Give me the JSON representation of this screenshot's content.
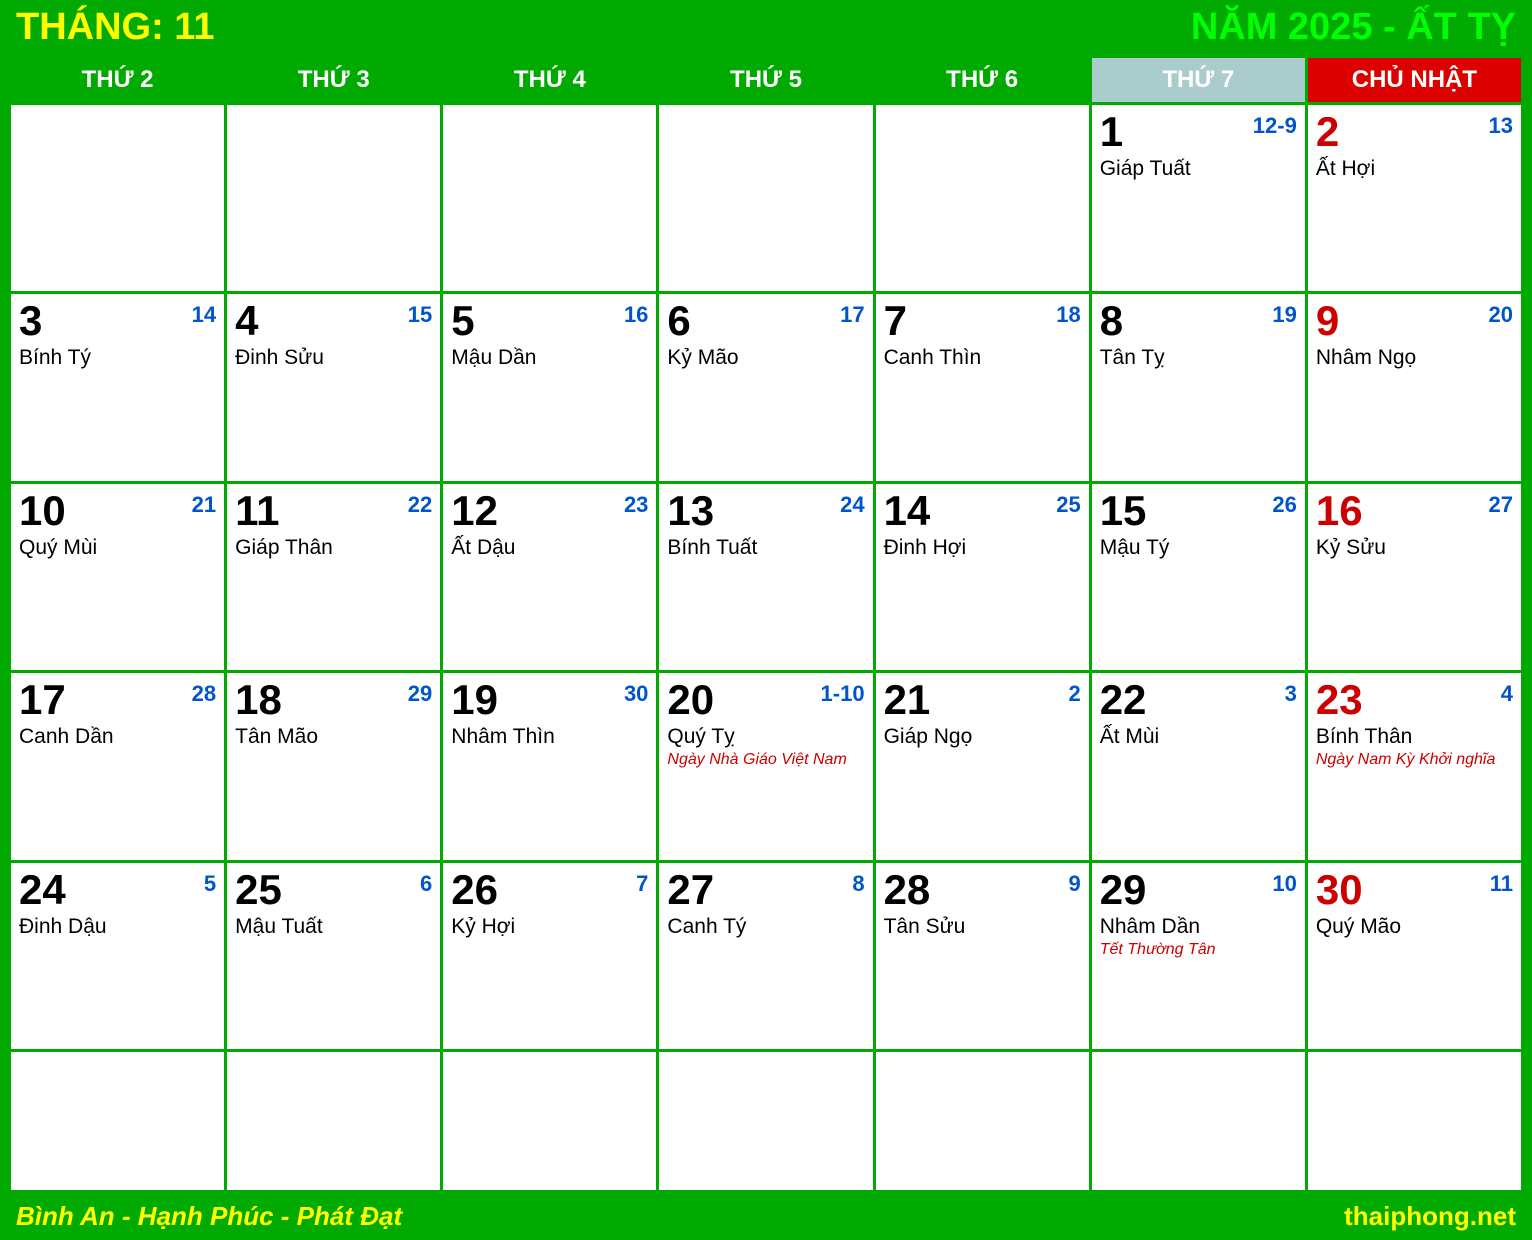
{
  "header": {
    "month_label": "THÁNG: 11",
    "year_label": "NĂM 2025 - ẤT TỴ"
  },
  "weekdays": [
    {
      "label": "THỨ 2",
      "type": "normal"
    },
    {
      "label": "THỨ 3",
      "type": "normal"
    },
    {
      "label": "THỨ 4",
      "type": "normal"
    },
    {
      "label": "THỨ 5",
      "type": "normal"
    },
    {
      "label": "THỨ 6",
      "type": "normal"
    },
    {
      "label": "THỨ 7",
      "type": "saturday"
    },
    {
      "label": "CHỦ NHẬT",
      "type": "sunday"
    }
  ],
  "rows": [
    [
      {
        "day": "",
        "lunar": "",
        "lunar_name": "",
        "event": "",
        "empty": true
      },
      {
        "day": "",
        "lunar": "",
        "lunar_name": "",
        "event": "",
        "empty": true
      },
      {
        "day": "",
        "lunar": "",
        "lunar_name": "",
        "event": "",
        "empty": true
      },
      {
        "day": "",
        "lunar": "",
        "lunar_name": "",
        "event": "",
        "empty": true
      },
      {
        "day": "",
        "lunar": "",
        "lunar_name": "",
        "event": "",
        "empty": true
      },
      {
        "day": "1",
        "lunar": "12-9",
        "lunar_name": "Giáp Tuất",
        "event": "",
        "empty": false,
        "is_sunday": false
      },
      {
        "day": "2",
        "lunar": "13",
        "lunar_name": "Ất Hợi",
        "event": "",
        "empty": false,
        "is_sunday": true
      }
    ],
    [
      {
        "day": "3",
        "lunar": "14",
        "lunar_name": "Bính Tý",
        "event": "",
        "empty": false,
        "is_sunday": false
      },
      {
        "day": "4",
        "lunar": "15",
        "lunar_name": "Đinh Sửu",
        "event": "",
        "empty": false,
        "is_sunday": false
      },
      {
        "day": "5",
        "lunar": "16",
        "lunar_name": "Mậu Dần",
        "event": "",
        "empty": false,
        "is_sunday": false
      },
      {
        "day": "6",
        "lunar": "17",
        "lunar_name": "Kỷ Mão",
        "event": "",
        "empty": false,
        "is_sunday": false
      },
      {
        "day": "7",
        "lunar": "18",
        "lunar_name": "Canh Thìn",
        "event": "",
        "empty": false,
        "is_sunday": false
      },
      {
        "day": "8",
        "lunar": "19",
        "lunar_name": "Tân Tỵ",
        "event": "",
        "empty": false,
        "is_sunday": false
      },
      {
        "day": "9",
        "lunar": "20",
        "lunar_name": "Nhâm Ngọ",
        "event": "",
        "empty": false,
        "is_sunday": true
      }
    ],
    [
      {
        "day": "10",
        "lunar": "21",
        "lunar_name": "Quý Mùi",
        "event": "",
        "empty": false,
        "is_sunday": false
      },
      {
        "day": "11",
        "lunar": "22",
        "lunar_name": "Giáp Thân",
        "event": "",
        "empty": false,
        "is_sunday": false
      },
      {
        "day": "12",
        "lunar": "23",
        "lunar_name": "Ất Dậu",
        "event": "",
        "empty": false,
        "is_sunday": false
      },
      {
        "day": "13",
        "lunar": "24",
        "lunar_name": "Bính Tuất",
        "event": "",
        "empty": false,
        "is_sunday": false
      },
      {
        "day": "14",
        "lunar": "25",
        "lunar_name": "Đinh Hợi",
        "event": "",
        "empty": false,
        "is_sunday": false
      },
      {
        "day": "15",
        "lunar": "26",
        "lunar_name": "Mậu Tý",
        "event": "",
        "empty": false,
        "is_sunday": false
      },
      {
        "day": "16",
        "lunar": "27",
        "lunar_name": "Kỷ Sửu",
        "event": "",
        "empty": false,
        "is_sunday": true
      }
    ],
    [
      {
        "day": "17",
        "lunar": "28",
        "lunar_name": "Canh Dần",
        "event": "",
        "empty": false,
        "is_sunday": false
      },
      {
        "day": "18",
        "lunar": "29",
        "lunar_name": "Tân Mão",
        "event": "",
        "empty": false,
        "is_sunday": false
      },
      {
        "day": "19",
        "lunar": "30",
        "lunar_name": "Nhâm Thìn",
        "event": "",
        "empty": false,
        "is_sunday": false
      },
      {
        "day": "20",
        "lunar": "1-10",
        "lunar_name": "Quý Tỵ",
        "event": "Ngày Nhà Giáo Việt Nam",
        "empty": false,
        "is_sunday": false
      },
      {
        "day": "21",
        "lunar": "2",
        "lunar_name": "Giáp Ngọ",
        "event": "",
        "empty": false,
        "is_sunday": false
      },
      {
        "day": "22",
        "lunar": "3",
        "lunar_name": "Ất Mùi",
        "event": "",
        "empty": false,
        "is_sunday": false
      },
      {
        "day": "23",
        "lunar": "4",
        "lunar_name": "Bính Thân",
        "event": "Ngày Nam Kỳ Khởi nghĩa",
        "empty": false,
        "is_sunday": true
      }
    ],
    [
      {
        "day": "24",
        "lunar": "5",
        "lunar_name": "Đinh Dậu",
        "event": "",
        "empty": false,
        "is_sunday": false
      },
      {
        "day": "25",
        "lunar": "6",
        "lunar_name": "Mậu Tuất",
        "event": "",
        "empty": false,
        "is_sunday": false
      },
      {
        "day": "26",
        "lunar": "7",
        "lunar_name": "Kỷ Hợi",
        "event": "",
        "empty": false,
        "is_sunday": false
      },
      {
        "day": "27",
        "lunar": "8",
        "lunar_name": "Canh Tý",
        "event": "",
        "empty": false,
        "is_sunday": false
      },
      {
        "day": "28",
        "lunar": "9",
        "lunar_name": "Tân Sửu",
        "event": "",
        "empty": false,
        "is_sunday": false
      },
      {
        "day": "29",
        "lunar": "10",
        "lunar_name": "Nhâm Dần",
        "event": "Tết Thường Tân",
        "empty": false,
        "is_sunday": false
      },
      {
        "day": "30",
        "lunar": "11",
        "lunar_name": "Quý Mão",
        "event": "",
        "empty": false,
        "is_sunday": true
      }
    ],
    [
      {
        "day": "",
        "lunar": "",
        "lunar_name": "",
        "event": "",
        "empty": true
      },
      {
        "day": "",
        "lunar": "",
        "lunar_name": "",
        "event": "",
        "empty": true
      },
      {
        "day": "",
        "lunar": "",
        "lunar_name": "",
        "event": "",
        "empty": true
      },
      {
        "day": "",
        "lunar": "",
        "lunar_name": "",
        "event": "",
        "empty": true
      },
      {
        "day": "",
        "lunar": "",
        "lunar_name": "",
        "event": "",
        "empty": true
      },
      {
        "day": "",
        "lunar": "",
        "lunar_name": "",
        "event": "",
        "empty": true
      },
      {
        "day": "",
        "lunar": "",
        "lunar_name": "",
        "event": "",
        "empty": true
      }
    ]
  ],
  "footer": {
    "left": "Bình An - Hạnh Phúc - Phát Đạt",
    "right": "thaiphong.net"
  }
}
